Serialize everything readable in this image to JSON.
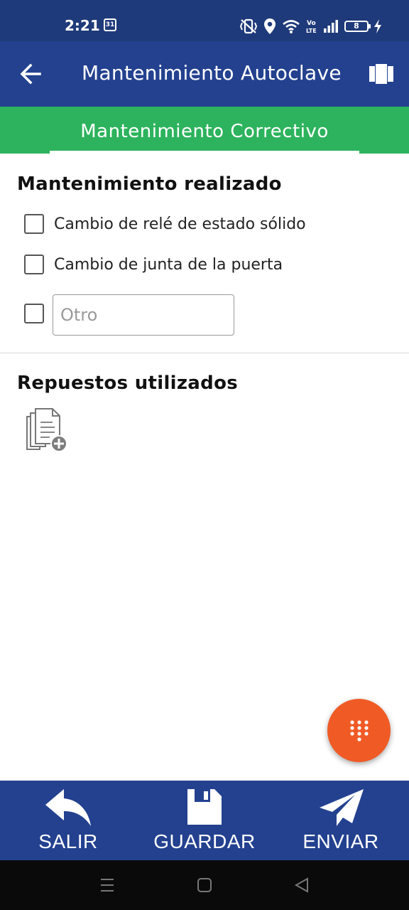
{
  "status_bar": {
    "time": "2:21",
    "calendar_day": "31",
    "battery_level": "8",
    "icons": [
      "calendar-icon",
      "vibrate-icon",
      "location-icon",
      "wifi-icon",
      "volte-icon",
      "signal-icon",
      "battery-icon",
      "charging-icon"
    ]
  },
  "app_bar": {
    "title": "Mantenimiento Autoclave",
    "back_icon": "arrow-left-icon",
    "action_icon": "board-icon",
    "color": "#23418f"
  },
  "tabs": [
    {
      "label": "Mantenimiento Correctivo",
      "selected": true
    }
  ],
  "tab_bar_color": "#2db35d",
  "maintenance_section": {
    "title": "Mantenimiento realizado",
    "items": [
      {
        "label": "Cambio de relé de estado sólido",
        "checked": false
      },
      {
        "label": "Cambio de junta de la puerta",
        "checked": false
      }
    ],
    "other": {
      "checked": false,
      "placeholder": "Otro",
      "value": ""
    }
  },
  "parts_section": {
    "title": "Repuestos utilizados",
    "add_icon": "add-document-icon"
  },
  "fab": {
    "icon": "dialpad-icon",
    "color": "#f05a25"
  },
  "actions": [
    {
      "label": "SALIR",
      "icon": "reply-icon"
    },
    {
      "label": "GUARDAR",
      "icon": "save-icon"
    },
    {
      "label": "ENVIAR",
      "icon": "send-icon"
    }
  ],
  "system_nav": [
    "menu-icon",
    "home-icon",
    "back-icon"
  ]
}
